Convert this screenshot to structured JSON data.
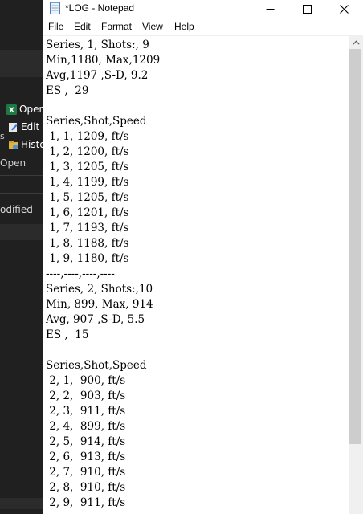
{
  "background_window": {
    "items": [
      {
        "label": "Open",
        "icon": "excel-icon"
      },
      {
        "label": "Edit",
        "icon": "edit-icon"
      },
      {
        "label": "History",
        "icon": "history-icon"
      }
    ],
    "left_fragment": "s",
    "section_label": "Open",
    "modified_label": "odified"
  },
  "notepad": {
    "title": "*LOG - Notepad",
    "menu": [
      "File",
      "Edit",
      "Format",
      "View",
      "Help"
    ],
    "lines": [
      "Series, 1, Shots:, 9",
      "Min,1180, Max,1209",
      "Avg,1197 ,S-D, 9.2",
      "ES ,  29",
      "",
      "Series,Shot,Speed",
      " 1, 1, 1209, ft/s",
      " 1, 2, 1200, ft/s",
      " 1, 3, 1205, ft/s",
      " 1, 4, 1199, ft/s",
      " 1, 5, 1205, ft/s",
      " 1, 6, 1201, ft/s",
      " 1, 7, 1193, ft/s",
      " 1, 8, 1188, ft/s",
      " 1, 9, 1180, ft/s",
      "----,----,----,----",
      "Series, 2, Shots:,10",
      "Min, 899, Max, 914",
      "Avg, 907 ,S-D, 5.5",
      "ES ,  15",
      "",
      "Series,Shot,Speed",
      " 2, 1,  900, ft/s",
      " 2, 2,  903, ft/s",
      " 2, 3,  911, ft/s",
      " 2, 4,  899, ft/s",
      " 2, 5,  914, ft/s",
      " 2, 6,  913, ft/s",
      " 2, 7,  910, ft/s",
      " 2, 8,  910, ft/s",
      " 2, 9,  911, ft/s"
    ]
  },
  "colors": {
    "desktop_bg": "#202020",
    "explorer_band": "#2b2b2b",
    "scrollbar_thumb": "#cdcdcd"
  }
}
